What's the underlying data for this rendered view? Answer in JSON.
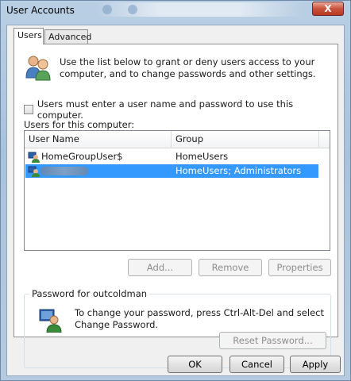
{
  "window": {
    "title": "User Accounts",
    "close_label": "X"
  },
  "tabs": [
    {
      "label": "Users",
      "active": true
    },
    {
      "label": "Advanced",
      "active": false
    }
  ],
  "intro_text": "Use the list below to grant or deny users access to your computer, and to change passwords and other settings.",
  "require_login": {
    "label": "Users must enter a user name and password to use this computer.",
    "checked": false
  },
  "users_list": {
    "label": "Users for this computer:",
    "columns": [
      "User Name",
      "Group"
    ],
    "rows": [
      {
        "name": "HomeGroupUser$",
        "group": "HomeUsers",
        "selected": false,
        "name_obscured": false
      },
      {
        "name": "",
        "group": "HomeUsers; Administrators",
        "selected": true,
        "name_obscured": true
      }
    ]
  },
  "list_buttons": {
    "add": "Add...",
    "remove": "Remove",
    "properties": "Properties"
  },
  "password_section": {
    "title": "Password for outcoldman",
    "text": "To change your password, press Ctrl-Alt-Del and select Change Password.",
    "reset_button": "Reset Password..."
  },
  "dialog_buttons": {
    "ok": "OK",
    "cancel": "Cancel",
    "apply": "Apply"
  },
  "colors": {
    "selection": "#3399ff",
    "frame": "#b9cfe4",
    "close_button": "#c9523c"
  }
}
